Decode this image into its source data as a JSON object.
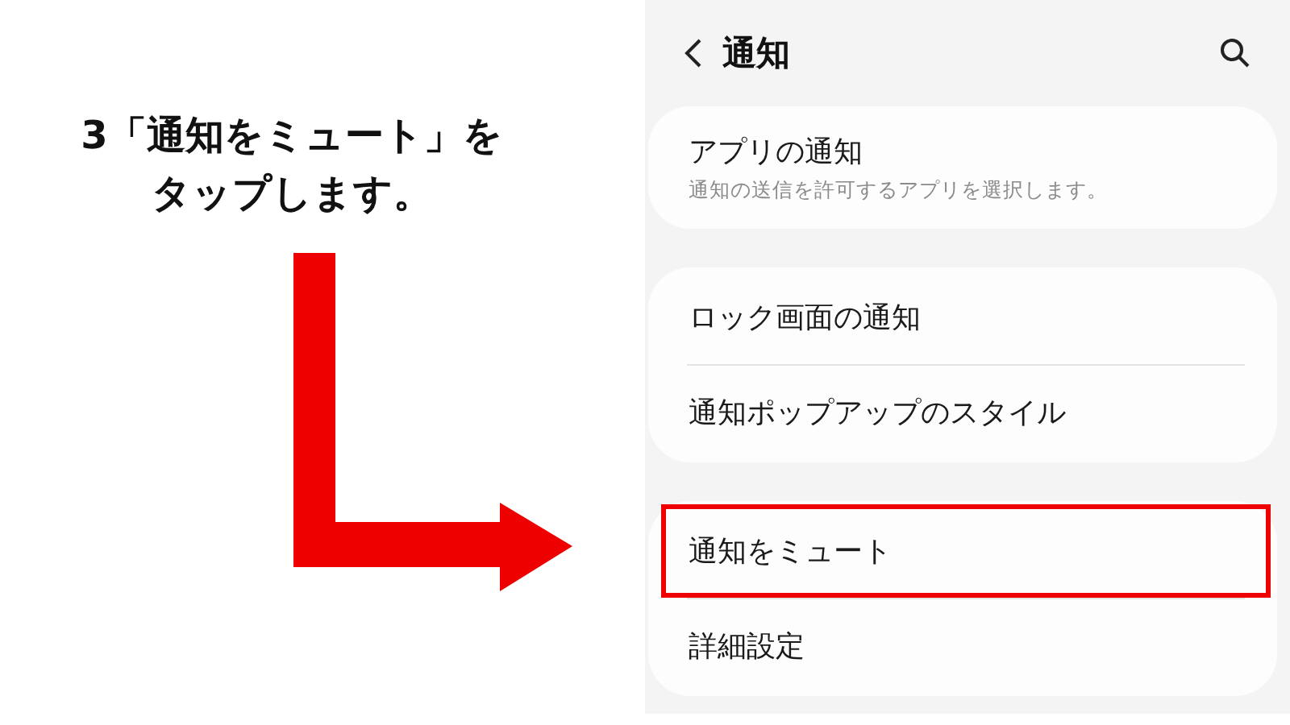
{
  "instruction": {
    "lines": [
      "3「通知をミュート」を",
      "タップします。"
    ]
  },
  "screen": {
    "title": "通知",
    "groups": [
      {
        "items": [
          {
            "title": "アプリの通知",
            "subtitle": "通知の送信を許可するアプリを選択します。",
            "highlighted": false
          }
        ]
      },
      {
        "items": [
          {
            "title": "ロック画面の通知",
            "highlighted": false
          },
          {
            "title": "通知ポップアップのスタイル",
            "highlighted": false
          }
        ]
      },
      {
        "items": [
          {
            "title": "通知をミュート",
            "highlighted": true
          },
          {
            "title": "詳細設定",
            "highlighted": false
          }
        ]
      }
    ]
  }
}
